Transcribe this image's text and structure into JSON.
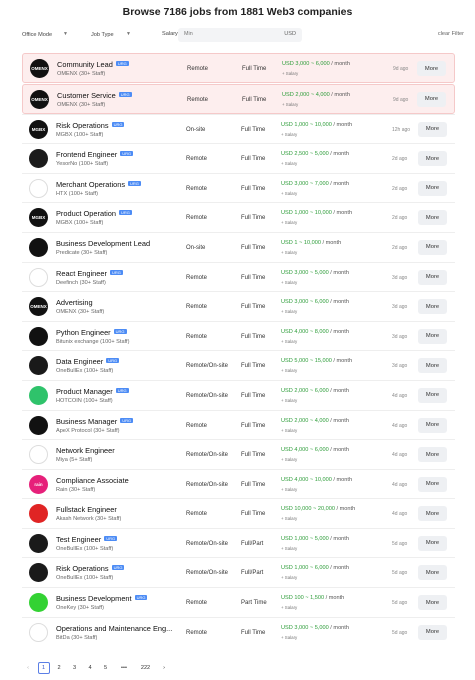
{
  "page": {
    "title": "Browse 7186 jobs from 1881 Web3 companies"
  },
  "filters": {
    "office_mode": "Office Mode",
    "job_type": "Job Type",
    "salary_label": "Salary",
    "salary_placeholder": "Min",
    "currency": "USD",
    "clear": "clear Filter"
  },
  "labels": {
    "more": "More",
    "salary_sub": "+ Salary",
    "per_month": " / month"
  },
  "jobs": [
    {
      "title": "Community Lead",
      "urg": "URG",
      "company": "OMENX (30+ Staff)",
      "location": "Remote",
      "type": "Full Time",
      "salary": "USD 3,000 ~ 6,000",
      "age": "9d ago"
    },
    {
      "title": "Customer Service",
      "urg": "URG",
      "company": "OMENX (30+ Staff)",
      "location": "Remote",
      "type": "Full Time",
      "salary": "USD 2,000 ~ 4,000",
      "age": "9d ago"
    },
    {
      "title": "Risk Operations",
      "urg": "URG",
      "company": "MGBX (100+ Staff)",
      "location": "On-site",
      "type": "Full Time",
      "salary": "USD 1,000 ~ 10,000",
      "age": "12h ago"
    },
    {
      "title": "Frontend Engineer",
      "urg": "URG",
      "company": "YesorNo (100+ Staff)",
      "location": "Remote",
      "type": "Full Time",
      "salary": "USD 2,500 ~ 5,000",
      "age": "2d ago"
    },
    {
      "title": "Merchant Operations",
      "urg": "URG",
      "company": "HTX (100+ Staff)",
      "location": "Remote",
      "type": "Full Time",
      "salary": "USD 3,000 ~ 7,000",
      "age": "2d ago"
    },
    {
      "title": "Product Operation",
      "urg": "URG",
      "company": "MGBX (100+ Staff)",
      "location": "Remote",
      "type": "Full Time",
      "salary": "USD 1,000 ~ 10,000",
      "age": "2d ago"
    },
    {
      "title": "Business Development Lead",
      "urg": "",
      "company": "Predicate (30+ Staff)",
      "location": "On-site",
      "type": "Full Time",
      "salary": "USD 1 ~ 10,000",
      "age": "2d ago"
    },
    {
      "title": "React Engineer",
      "urg": "URG",
      "company": "Deefinch (30+ Staff)",
      "location": "Remote",
      "type": "Full Time",
      "salary": "USD 3,000 ~ 5,000",
      "age": "3d ago"
    },
    {
      "title": "Advertising",
      "urg": "",
      "company": "OMENX (30+ Staff)",
      "location": "Remote",
      "type": "Full Time",
      "salary": "USD 3,000 ~ 6,000",
      "age": "3d ago"
    },
    {
      "title": "Python Engineer",
      "urg": "URG",
      "company": "Bitunix exchange (100+ Staff)",
      "location": "Remote",
      "type": "Full Time",
      "salary": "USD 4,000 ~ 8,000",
      "age": "3d ago"
    },
    {
      "title": "Data Engineer",
      "urg": "URG",
      "company": "OneBullEx (100+ Staff)",
      "location": "Remote/On-site",
      "type": "Full Time",
      "salary": "USD 5,000 ~ 15,000",
      "age": "3d ago"
    },
    {
      "title": "Product Manager",
      "urg": "URG",
      "company": "HOTCOIN (100+ Staff)",
      "location": "Remote/On-site",
      "type": "Full Time",
      "salary": "USD 2,000 ~ 6,000",
      "age": "4d ago"
    },
    {
      "title": "Business Manager",
      "urg": "URG",
      "company": "ApeX Protocol (30+ Staff)",
      "location": "Remote",
      "type": "Full Time",
      "salary": "USD 2,000 ~ 4,000",
      "age": "4d ago"
    },
    {
      "title": "Network Engineer",
      "urg": "",
      "company": "Miya (5+ Staff)",
      "location": "Remote/On-site",
      "type": "Full Time",
      "salary": "USD 4,000 ~ 6,000",
      "age": "4d ago"
    },
    {
      "title": "Compliance Associate",
      "urg": "",
      "company": "Rain (30+ Staff)",
      "location": "Remote/On-site",
      "type": "Full Time",
      "salary": "USD 4,000 ~ 10,000",
      "age": "4d ago"
    },
    {
      "title": "Fullstack Engineer",
      "urg": "",
      "company": "Akash Network (30+ Staff)",
      "location": "Remote",
      "type": "Full Time",
      "salary": "USD 10,000 ~ 20,000",
      "age": "4d ago"
    },
    {
      "title": "Test Engineer",
      "urg": "URG",
      "company": "OneBullEx (100+ Staff)",
      "location": "Remote/On-site",
      "type": "Full/Part",
      "salary": "USD 1,000 ~ 5,000",
      "age": "5d ago"
    },
    {
      "title": "Risk Operations",
      "urg": "URG",
      "company": "OneBullEx (100+ Staff)",
      "location": "Remote/On-site",
      "type": "Full/Part",
      "salary": "USD 1,000 ~ 6,000",
      "age": "5d ago"
    },
    {
      "title": "Business Development",
      "urg": "URG",
      "company": "OneKey (30+ Staff)",
      "location": "Remote",
      "type": "Part Time",
      "salary": "USD 100 ~ 1,500",
      "age": "5d ago"
    },
    {
      "title": "Operations and Maintenance Eng...",
      "urg": "",
      "company": "BitDa (30+ Staff)",
      "location": "Remote",
      "type": "Full Time",
      "salary": "USD 3,000 ~ 5,000",
      "age": "5d ago"
    }
  ],
  "logos": [
    {
      "bg": "#111111",
      "text": "OMENX"
    },
    {
      "bg": "#111111",
      "text": "OMENX"
    },
    {
      "bg": "#111111",
      "text": "MGBX"
    },
    {
      "bg": "#1b1b1b",
      "text": ""
    },
    {
      "bg": "#ffffff",
      "text": ""
    },
    {
      "bg": "#111111",
      "text": "MGBX"
    },
    {
      "bg": "#111111",
      "text": ""
    },
    {
      "bg": "#ffffff",
      "text": ""
    },
    {
      "bg": "#111111",
      "text": "OMENX"
    },
    {
      "bg": "#111111",
      "text": ""
    },
    {
      "bg": "#1a1a1a",
      "text": ""
    },
    {
      "bg": "#2fc36b",
      "text": ""
    },
    {
      "bg": "#111111",
      "text": ""
    },
    {
      "bg": "#ffffff",
      "text": ""
    },
    {
      "bg": "#e6207a",
      "text": "rain"
    },
    {
      "bg": "#e02424",
      "text": ""
    },
    {
      "bg": "#1a1a1a",
      "text": ""
    },
    {
      "bg": "#1a1a1a",
      "text": ""
    },
    {
      "bg": "#33d233",
      "text": ""
    },
    {
      "bg": "#ffffff",
      "text": ""
    }
  ],
  "pagination": {
    "pages": [
      "1",
      "2",
      "3",
      "4",
      "5",
      "•••",
      "222"
    ],
    "prev": "‹",
    "next": "›",
    "current": "1"
  },
  "colors": {
    "accent": "#4d8cf5",
    "salary": "#2e9d3a",
    "highlight": "#fdeeee"
  }
}
